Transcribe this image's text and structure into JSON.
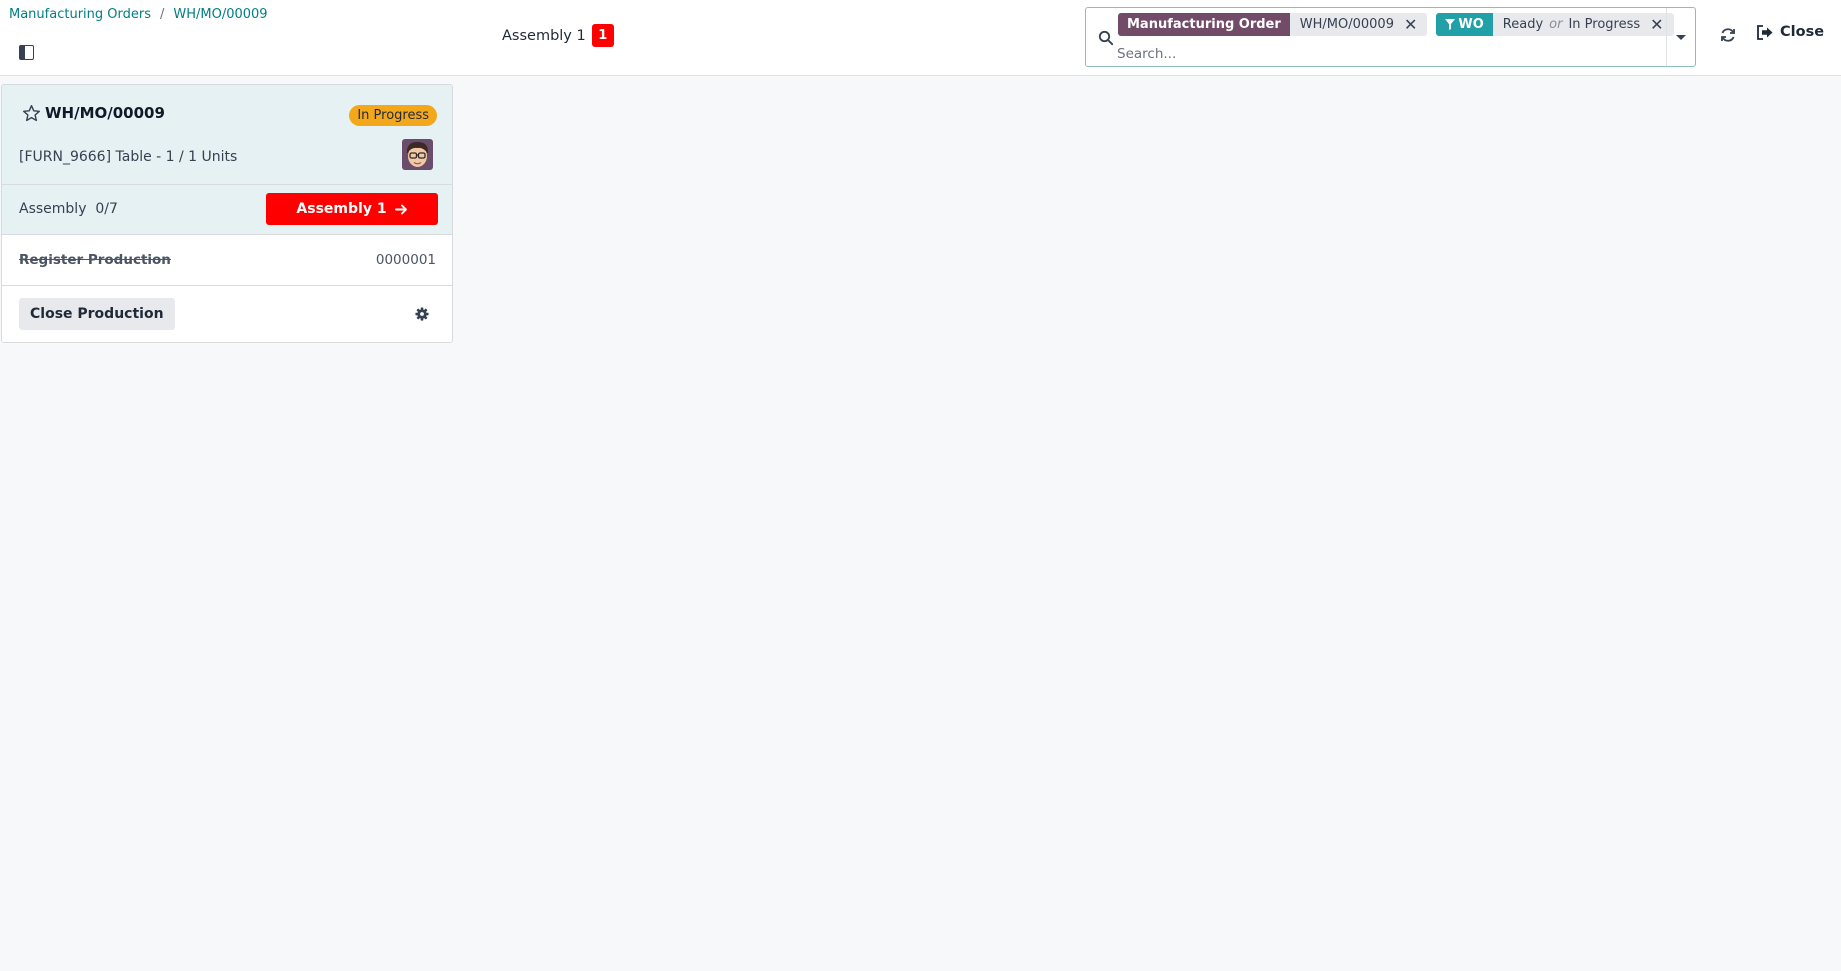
{
  "breadcrumb": {
    "root": "Manufacturing Orders",
    "separator": "/",
    "current": "WH/MO/00009"
  },
  "workcenter_tab": {
    "label": "Assembly 1",
    "count": "1"
  },
  "search": {
    "facets": [
      {
        "name": "Manufacturing Order",
        "value": "WH/MO/00009"
      },
      {
        "name": "WO",
        "value_a": "Ready",
        "connector": "or",
        "value_b": "In Progress"
      }
    ],
    "placeholder": "Search..."
  },
  "header_actions": {
    "close_label": "Close"
  },
  "card": {
    "name": "WH/MO/00009",
    "status": "In Progress",
    "product": "[FURN_9666] Table - 1 / 1 Units",
    "workorder": {
      "label": "Assembly",
      "progress": "0/7",
      "button_label": "Assembly 1"
    },
    "register": {
      "label": "Register Production",
      "value": "0000001"
    },
    "close_button": "Close Production"
  },
  "colors": {
    "accent": "#017e84",
    "mo_facet": "#714b67",
    "wo_facet": "#21a0a7",
    "status": "#f3a71b",
    "workorder_button": "#ff0000"
  },
  "icons": [
    "search-icon",
    "filter-icon",
    "close-icon",
    "refresh-icon",
    "sign-out-icon",
    "star-icon",
    "arrow-right-icon",
    "gear-icon",
    "sidebar-toggle-icon",
    "caret-down-icon"
  ]
}
